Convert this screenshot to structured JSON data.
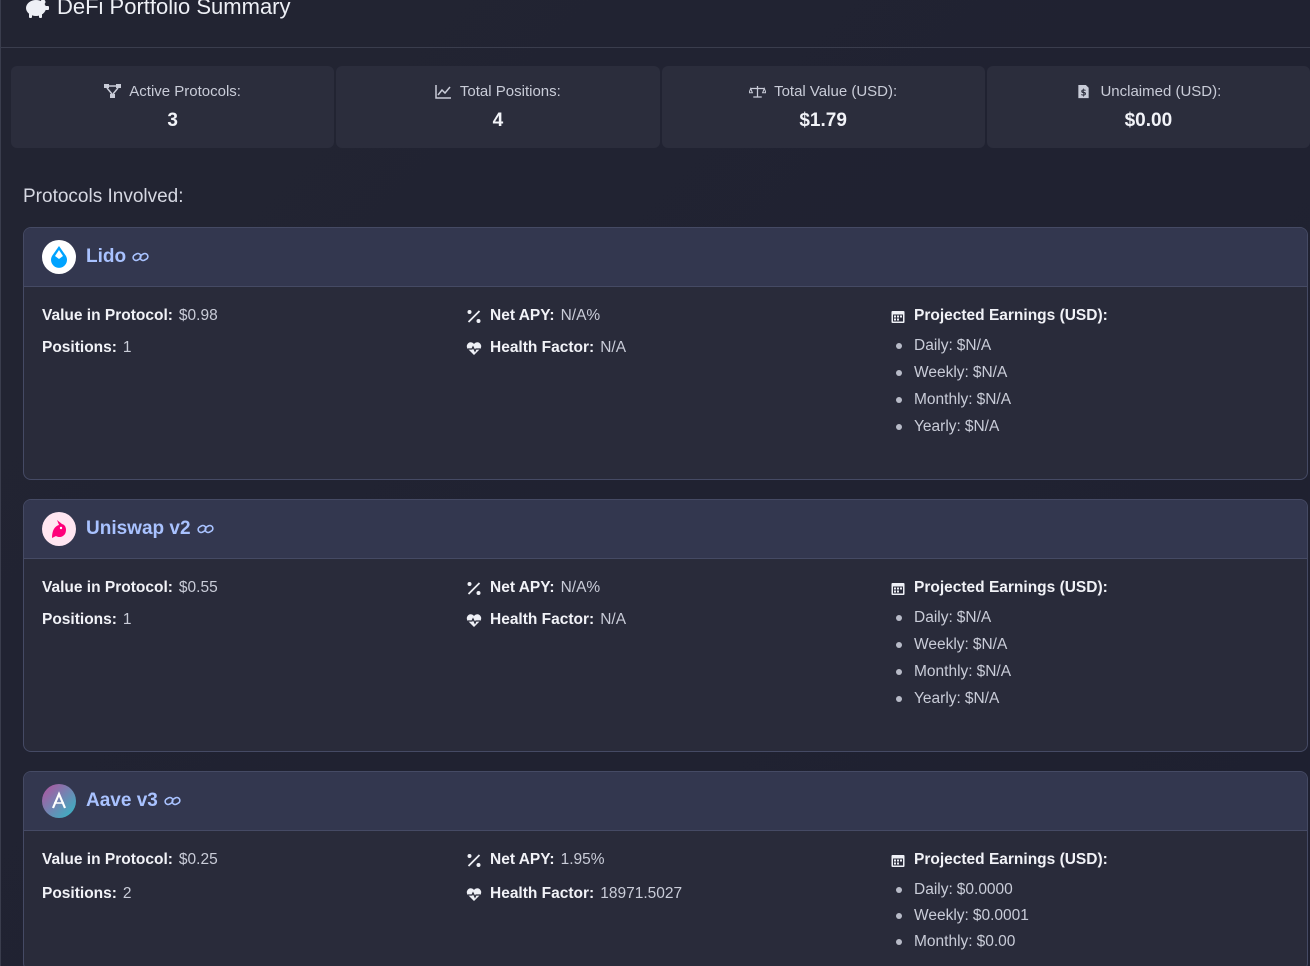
{
  "header": {
    "title": "DeFi Portfolio Summary",
    "icon": "piggy-bank-icon"
  },
  "summary": [
    {
      "label": "Active Protocols:",
      "value": "3",
      "icon": "network-icon"
    },
    {
      "label": "Total Positions:",
      "value": "4",
      "icon": "line-chart-icon"
    },
    {
      "label": "Total Value (USD):",
      "value": "$1.79",
      "icon": "balance-scale-icon"
    },
    {
      "label": "Unclaimed (USD):",
      "value": "$0.00",
      "icon": "dollar-file-icon"
    }
  ],
  "protocols_heading": "Protocols Involved:",
  "labels": {
    "value": "Value in Protocol:",
    "positions": "Positions:",
    "apy": "Net APY:",
    "health": "Health Factor:",
    "projected": "Projected Earnings (USD):",
    "daily": "Daily:",
    "weekly": "Weekly:",
    "monthly": "Monthly:",
    "yearly": "Yearly:"
  },
  "protocols": [
    {
      "name": "Lido",
      "logo_color": "#00a3ff",
      "value": "$0.98",
      "positions": "1",
      "apy": "N/A%",
      "health": "N/A",
      "daily": "$N/A",
      "weekly": "$N/A",
      "monthly": "$N/A",
      "yearly": "$N/A"
    },
    {
      "name": "Uniswap v2",
      "logo_color": "#ff007a",
      "value": "$0.55",
      "positions": "1",
      "apy": "N/A%",
      "health": "N/A",
      "daily": "$N/A",
      "weekly": "$N/A",
      "monthly": "$N/A",
      "yearly": "$N/A"
    },
    {
      "name": "Aave v3",
      "logo_color": "#9a5cc8",
      "value": "$0.25",
      "positions": "2",
      "apy": "1.95%",
      "health": "18971.5027",
      "daily": "$0.0000",
      "weekly": "$0.0001",
      "monthly": "$0.00"
    }
  ]
}
